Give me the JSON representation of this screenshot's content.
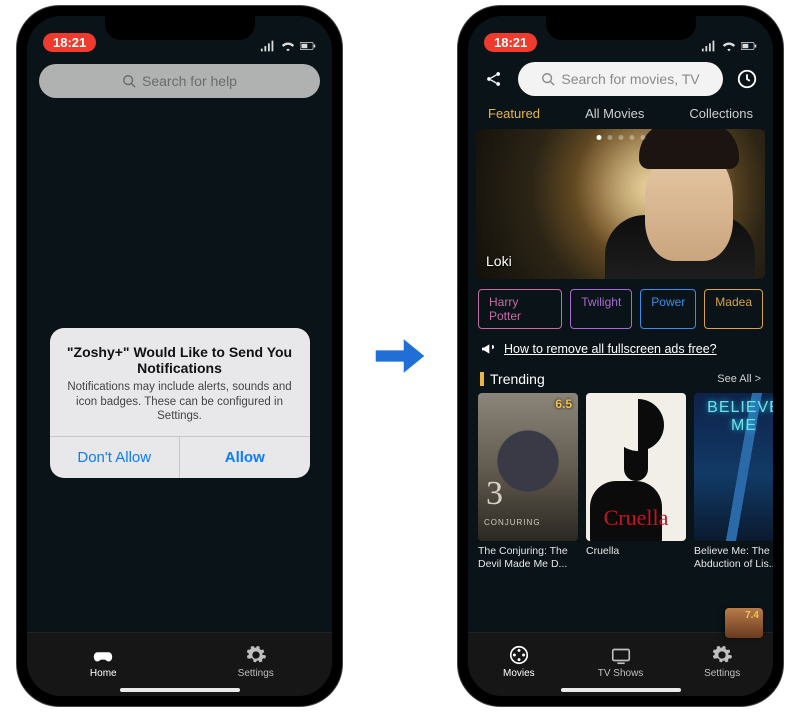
{
  "status": {
    "time": "18:21"
  },
  "phoneA": {
    "search_placeholder": "Search for help",
    "modal": {
      "title": "\"Zoshy+\" Would Like to Send You Notifications",
      "message": "Notifications may include alerts, sounds and icon badges. These can be configured in Settings.",
      "deny": "Don't Allow",
      "allow": "Allow"
    },
    "tabs": {
      "home": "Home",
      "settings": "Settings"
    }
  },
  "phoneB": {
    "search_placeholder": "Search for movies, TV",
    "nav": {
      "featured": "Featured",
      "all": "All Movies",
      "collections": "Collections"
    },
    "hero_title": "Loki",
    "chips": [
      {
        "label": "Harry Potter",
        "color": "#c86aa5"
      },
      {
        "label": "Twilight",
        "color": "#a66ad1"
      },
      {
        "label": "Power",
        "color": "#3b8de6"
      },
      {
        "label": "Madea",
        "color": "#d7a24a"
      }
    ],
    "promo": "How to remove all fullscreen ads free?",
    "section": {
      "title": "Trending",
      "see_all": "See All >"
    },
    "cards": [
      {
        "title": "The Conjuring: The Devil Made Me D...",
        "rating": "6.5",
        "poster_logo": ""
      },
      {
        "title": "Cruella",
        "rating": "",
        "poster_logo": "Cruella"
      },
      {
        "title": "Believe Me: The Abduction of Lis...",
        "rating": "",
        "poster_logo": "BELIEVE ME"
      }
    ],
    "mini_rating": "7.4",
    "tabs": {
      "movies": "Movies",
      "tv": "TV Shows",
      "settings": "Settings"
    }
  }
}
